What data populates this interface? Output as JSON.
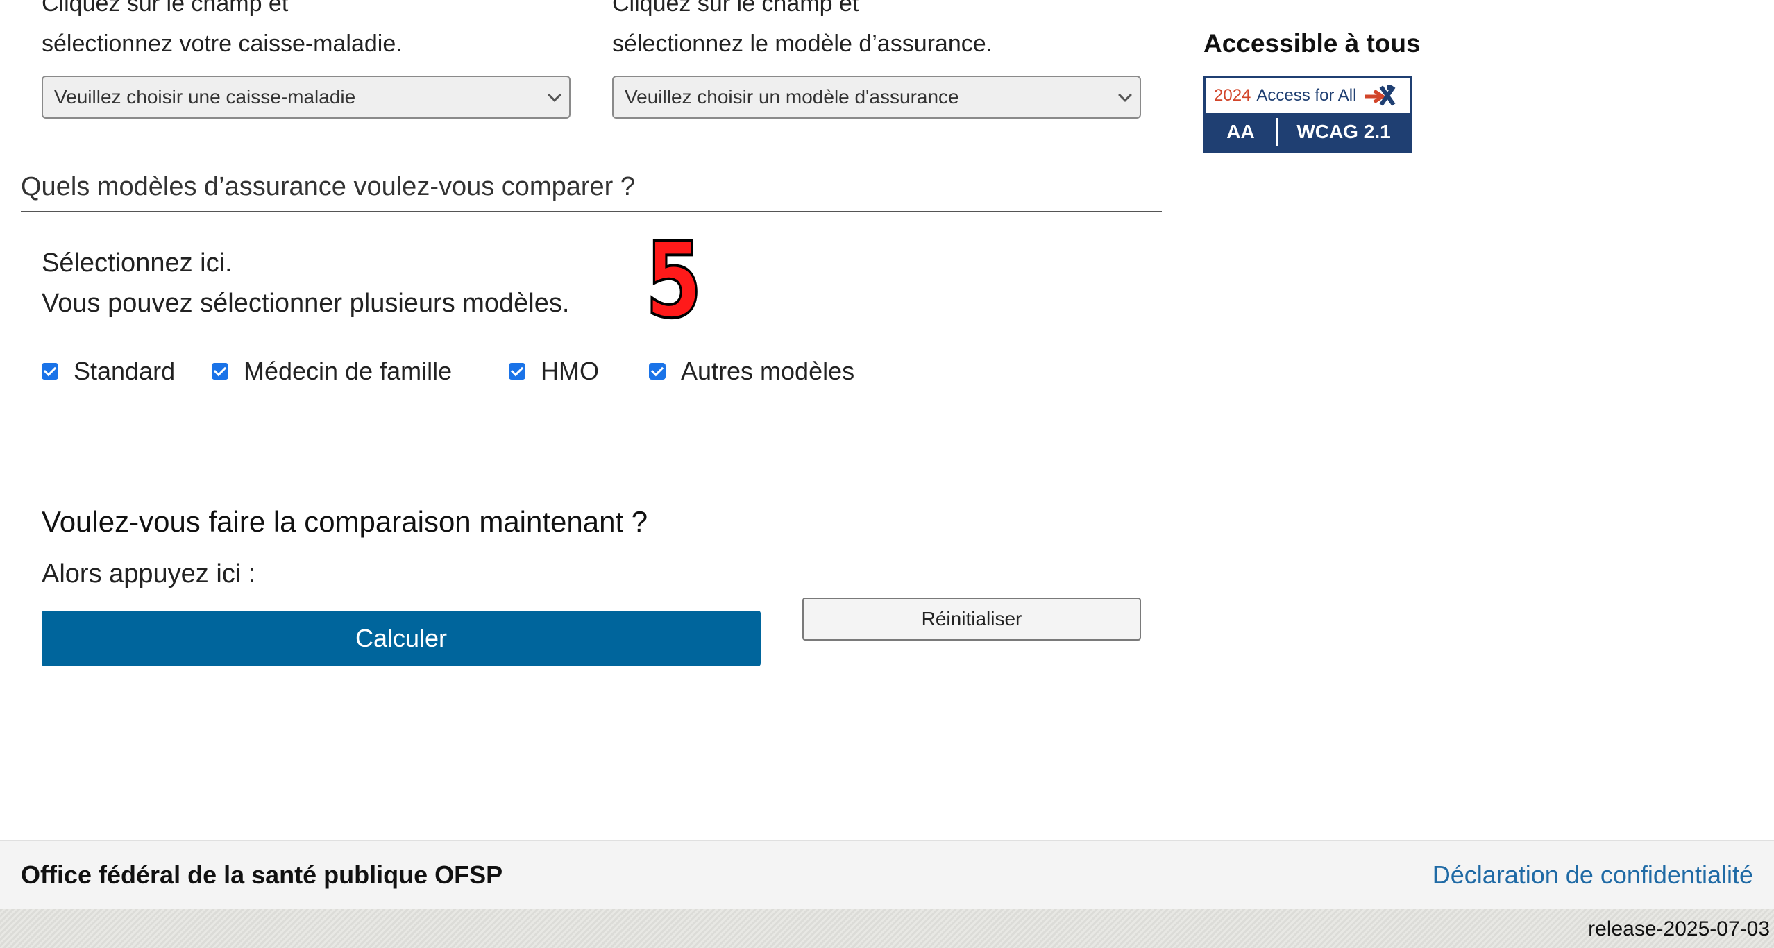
{
  "left_column": {
    "prompt": "Cliquez sur le champ et\nsélectionnez votre caisse-maladie.",
    "select_value": "Veuillez choisir une caisse-maladie"
  },
  "right_column": {
    "prompt": "Cliquez sur le champ et\nsélectionnez le modèle d’assurance.",
    "select_value": "Veuillez choisir un modèle d'assurance"
  },
  "accessibility": {
    "title": "Accessible à tous",
    "badge_year": "2024",
    "badge_text": "Access for All",
    "badge_level": "AA",
    "badge_standard": "WCAG 2.1"
  },
  "models_section": {
    "title": "Quels modèles d’assurance voulez-vous comparer ?",
    "instructions": "Sélectionnez ici.\nVous pouvez sélectionner plusieurs modèles.",
    "step_marker": "5",
    "options": [
      {
        "label": "Standard",
        "checked": true
      },
      {
        "label": "Médecin de famille",
        "checked": true
      },
      {
        "label": "HMO",
        "checked": true
      },
      {
        "label": "Autres modèles",
        "checked": true
      }
    ]
  },
  "compare": {
    "question": "Voulez-vous faire la comparaison maintenant ?",
    "hint": "Alors appuyez ici :",
    "calculate_label": "Calculer",
    "reset_label": "Réinitialiser"
  },
  "footer": {
    "organization": "Office fédéral de la santé publique OFSP",
    "privacy_link": "Déclaration de confidentialité"
  },
  "release": "release-2025-07-03"
}
